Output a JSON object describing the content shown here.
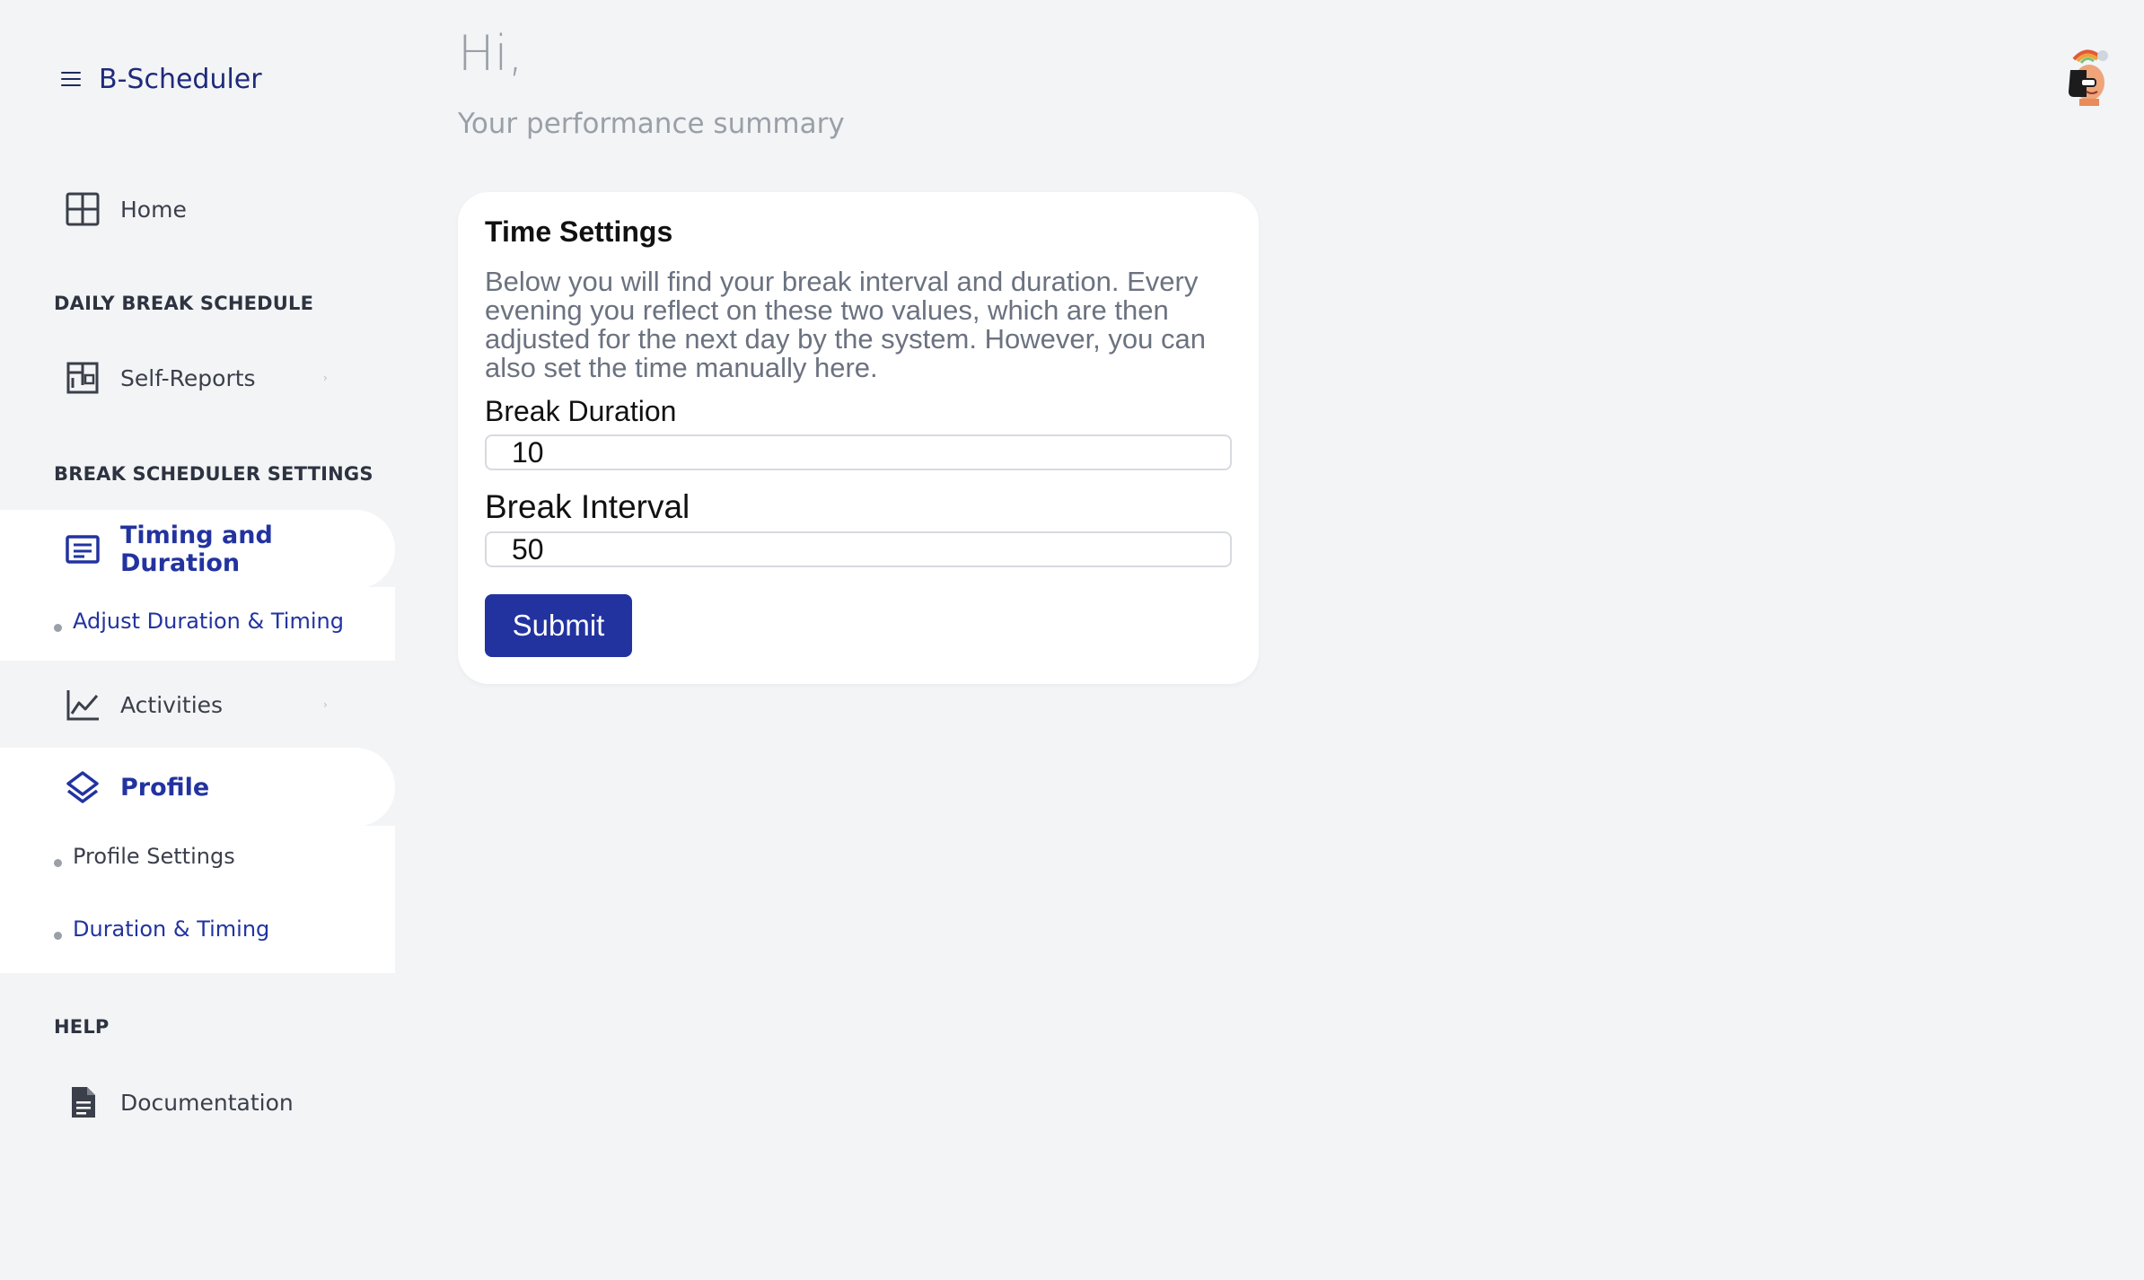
{
  "app": {
    "title": "B-Scheduler"
  },
  "header": {
    "greeting": "Hi,",
    "subtitle": "Your performance summary"
  },
  "sidebar": {
    "home": "Home",
    "section_daily": "DAILY BREAK SCHEDULE",
    "self_reports": "Self-Reports",
    "section_settings": "BREAK SCHEDULER SETTINGS",
    "timing_duration": "Timing and Duration",
    "adjust_duration_timing": "Adjust Duration & Timing",
    "activities": "Activities",
    "profile": "Profile",
    "profile_settings": "Profile Settings",
    "duration_timing": "Duration & Timing",
    "section_help": "HELP",
    "documentation": "Documentation"
  },
  "card": {
    "title": "Time Settings",
    "description": "Below you will find your break interval and duration. Every evening you reflect on these two values, which are then adjusted for the next day by the system. However, you can also set the time manually here.",
    "break_duration_label": "Break Duration",
    "break_duration_value": "10",
    "break_interval_label": "Break Interval",
    "break_interval_value": "50",
    "submit_label": "Submit"
  },
  "colors": {
    "accent": "#2233a0",
    "background": "#f3f4f6",
    "card": "#ffffff"
  },
  "icons": [
    "menu-icon",
    "grid-icon",
    "dashboard-icon",
    "list-icon",
    "chart-icon",
    "layers-icon",
    "document-icon",
    "avatar-image"
  ]
}
